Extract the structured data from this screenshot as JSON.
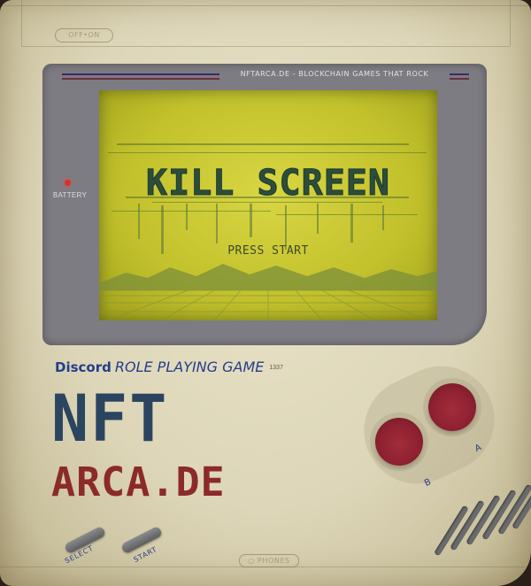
{
  "device": {
    "power_label": "OFF•ON",
    "bezel_title": "NFTARCA.DE - BLOCKCHAIN GAMES THAT ROCK",
    "battery_label": "BATTERY",
    "phones_label": "○ PHONES"
  },
  "screen": {
    "game_title": "KILL SCREEN",
    "prompt": "PRESS START"
  },
  "tagline": {
    "discord": "Discord",
    "subtitle": "ROLE PLAYING GAME",
    "number": "1337"
  },
  "logo": {
    "line1": "NFT",
    "line2": "ARCA.DE"
  },
  "buttons": {
    "a_label": "A",
    "b_label": "B",
    "select_label": "SELECT",
    "start_label": "START"
  },
  "colors": {
    "screen": "#c9c72f",
    "logo_blue": "#2b4560",
    "logo_red": "#8c2a2a",
    "button_red": "#8e2131",
    "accent_blue": "#253e8a"
  }
}
